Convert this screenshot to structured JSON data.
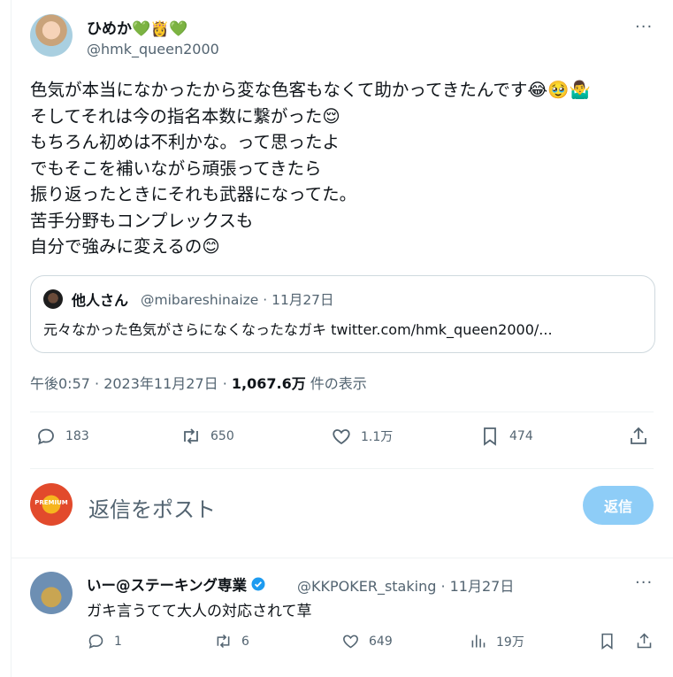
{
  "tweet": {
    "display_name": "ひめか💚👸💚",
    "handle": "@hmk_queen2000",
    "more": "···",
    "lines": [
      "色気が本当になかったから変な色客もなくて助かってきたんです😂🥹🤷‍♂️",
      "そしてそれは今の指名本数に繋がった😌",
      "もちろん初めは不利かな。って思ったよ",
      "でもそこを補いながら頑張ってきたら",
      "振り返ったときにそれも武器になってた。",
      "苦手分野もコンプレックスも",
      "自分で強みに変えるの😊"
    ],
    "quote": {
      "name": "他人さん",
      "meta": "@mibareshinaize · 11月27日",
      "text": "元々なかった色気がさらになくなったなガキ twitter.com/hmk_queen2000/..."
    },
    "timestamp": "午後0:57 · 2023年11月27日 · ",
    "views_count": "1,067.6万",
    "views_label": " 件の表示",
    "stats": {
      "replies": "183",
      "retweets": "650",
      "likes": "1.1万",
      "bookmarks": "474"
    }
  },
  "compose": {
    "avatar_label": "PREMIUM",
    "placeholder": "返信をポスト",
    "button": "返信"
  },
  "reply": {
    "name": "いー@ステーキング専業",
    "meta": "@KKPOKER_staking · 11月27日",
    "more": "···",
    "text": "ガキ言うてて大人の対応されて草",
    "stats": {
      "replies": "1",
      "retweets": "6",
      "likes": "649",
      "views": "19万"
    }
  },
  "colors": {
    "accent_disabled": "#8ecdf7",
    "verified": "#1d9bf0",
    "muted": "#536471"
  }
}
